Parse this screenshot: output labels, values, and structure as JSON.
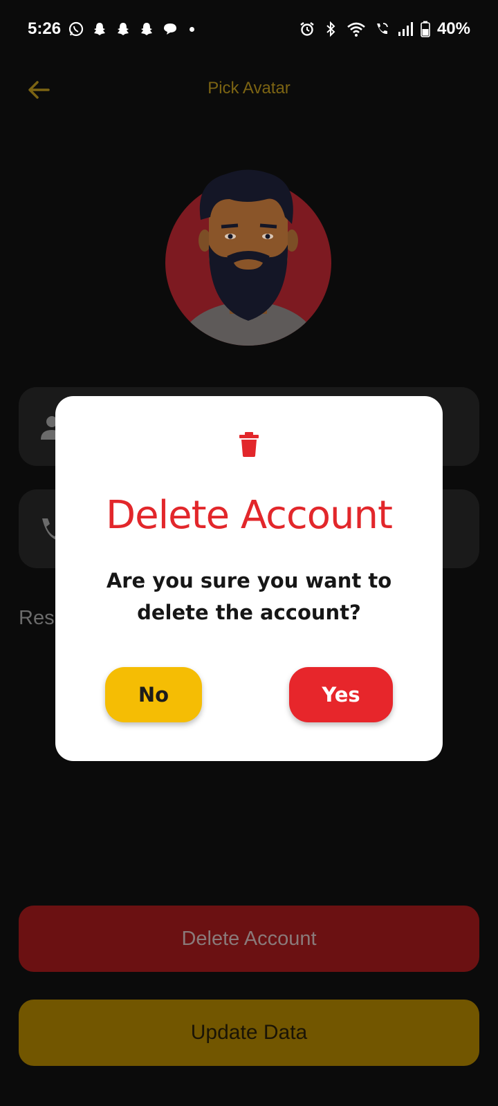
{
  "status_bar": {
    "time": "5:26",
    "battery": "40%",
    "left_icons": [
      "whatsapp-icon",
      "snapchat-icon",
      "snapchat-icon",
      "snapchat-icon",
      "chat-bubble-icon",
      "more-dot"
    ],
    "right_icons": [
      "alarm-icon",
      "bluetooth-icon",
      "wifi-icon",
      "wifi-calling-icon",
      "signal-icon",
      "battery-icon"
    ]
  },
  "app_bar": {
    "title": "Pick Avatar",
    "back_icon": "arrow-back-icon"
  },
  "form": {
    "name_icon": "person-icon",
    "phone_icon": "phone-icon",
    "reset_text": "Res"
  },
  "buttons": {
    "delete_label": "Delete Account",
    "update_label": "Update Data"
  },
  "dialog": {
    "icon": "trash-icon",
    "title": "Delete Account",
    "message": "Are you sure you want to delete the account?",
    "no_label": "No",
    "yes_label": "Yes"
  },
  "colors": {
    "accent_gold": "#f5bd04",
    "danger_red": "#e7262b",
    "background": "#0b0b0b"
  }
}
